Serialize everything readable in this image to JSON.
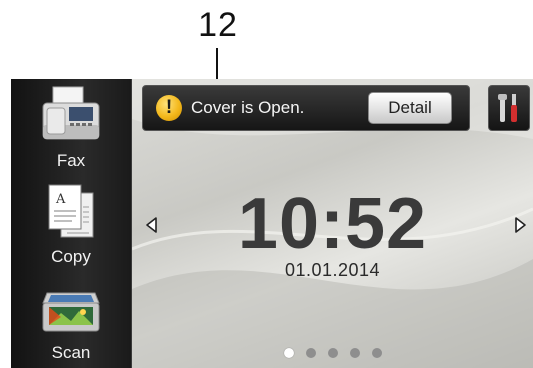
{
  "callout": {
    "number": "12"
  },
  "sidebar": {
    "items": [
      {
        "label": "Fax",
        "icon": "fax-icon"
      },
      {
        "label": "Copy",
        "icon": "copy-icon"
      },
      {
        "label": "Scan",
        "icon": "scan-icon"
      }
    ]
  },
  "status": {
    "icon": "warning-icon",
    "message": "Cover is Open.",
    "detail_label": "Detail"
  },
  "tools": {
    "icon": "tools-icon"
  },
  "clock": {
    "time": "10:52",
    "date": "01.01.2014"
  },
  "pager": {
    "count": 5,
    "active_index": 0
  },
  "colors": {
    "warning": "#f3b81c",
    "screen_bg": "#1d1d1d"
  }
}
